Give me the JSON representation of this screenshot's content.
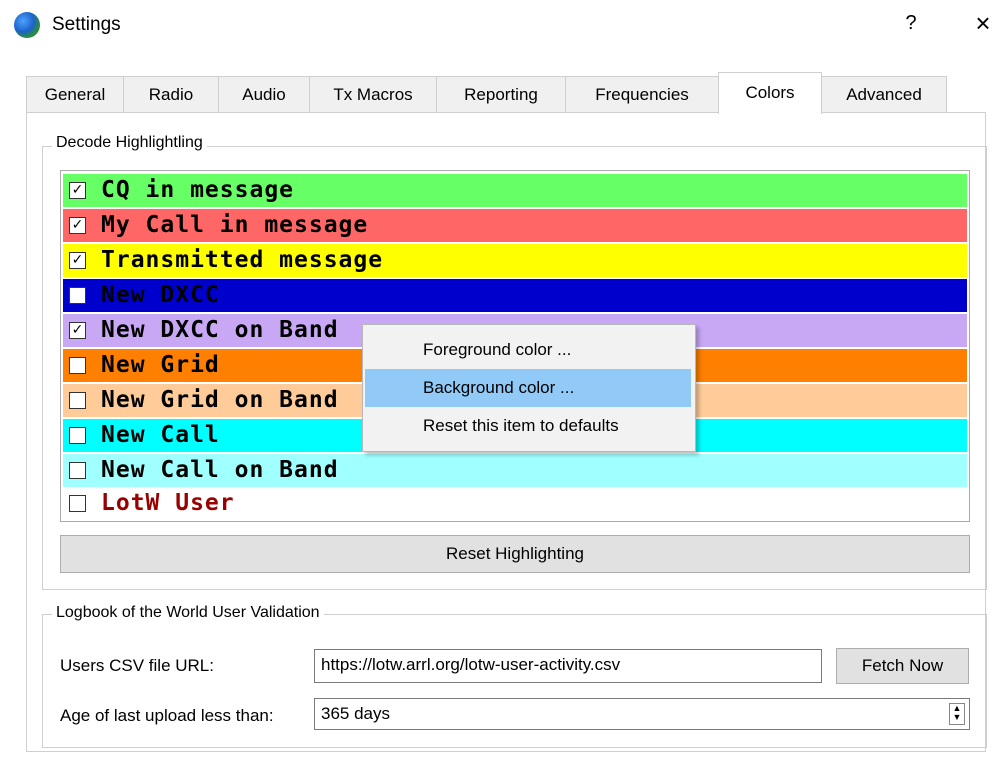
{
  "window": {
    "title": "Settings",
    "help_label": "?",
    "close_label": "×"
  },
  "tabs": [
    {
      "label": "General"
    },
    {
      "label": "Radio"
    },
    {
      "label": "Audio"
    },
    {
      "label": "Tx Macros"
    },
    {
      "label": "Reporting"
    },
    {
      "label": "Frequencies"
    },
    {
      "label": "Colors",
      "active": true
    },
    {
      "label": "Advanced"
    }
  ],
  "decode_highlighting": {
    "title": "Decode Highlightling",
    "items": [
      {
        "label": "CQ in message",
        "checked": true,
        "bg": "#66ff66",
        "fg": "#000000"
      },
      {
        "label": "My Call in message",
        "checked": true,
        "bg": "#ff6666",
        "fg": "#000000"
      },
      {
        "label": "Transmitted message",
        "checked": true,
        "bg": "#ffff00",
        "fg": "#000000"
      },
      {
        "label": "New DXCC",
        "checked": false,
        "bg": "#0000cc",
        "fg": "#000000"
      },
      {
        "label": "New DXCC on Band",
        "checked": true,
        "bg": "#c8a8f5",
        "fg": "#000000"
      },
      {
        "label": "New Grid",
        "checked": false,
        "bg": "#ff7f00",
        "fg": "#000000"
      },
      {
        "label": "New Grid on Band",
        "checked": false,
        "bg": "#ffcc99",
        "fg": "#000000"
      },
      {
        "label": "New Call",
        "checked": false,
        "bg": "#00ffff",
        "fg": "#000000"
      },
      {
        "label": "New Call on Band",
        "checked": false,
        "bg": "#a0ffff",
        "fg": "#000000"
      },
      {
        "label": "LotW User",
        "checked": false,
        "bg": "#ffffff",
        "fg": "#990000"
      }
    ],
    "checkmark": "✓",
    "reset_button": "Reset Highlighting"
  },
  "context_menu": {
    "items": [
      {
        "label": "Foreground color ..."
      },
      {
        "label": "Background color ...",
        "hover": true
      },
      {
        "label": "Reset this item to defaults"
      }
    ]
  },
  "lotw": {
    "title": "Logbook of the World User Validation",
    "csv_label": "Users CSV file URL:",
    "csv_value": "https://lotw.arrl.org/lotw-user-activity.csv",
    "fetch_button": "Fetch Now",
    "age_label": "Age of last upload less than:",
    "age_value": "365 days",
    "spin_up": "▲",
    "spin_down": "▼"
  }
}
